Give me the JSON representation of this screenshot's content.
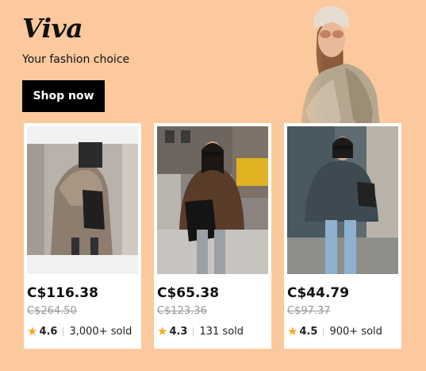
{
  "brand": {
    "name": "Viva",
    "tagline": "Your fashion choice"
  },
  "cta": {
    "label": "Shop now"
  },
  "products": [
    {
      "price": "C$116.38",
      "original_price": "C$264.50",
      "rating": "4.6",
      "sold": "3,000+ sold"
    },
    {
      "price": "C$65.38",
      "original_price": "C$123.36",
      "rating": "4.3",
      "sold": "131 sold"
    },
    {
      "price": "C$44.79",
      "original_price": "C$97.37",
      "rating": "4.5",
      "sold": "900+ sold"
    }
  ],
  "icons": {
    "rating": "star-icon"
  },
  "colors": {
    "background": "#fbc99d",
    "button": "#000000",
    "star": "#f5a623"
  }
}
